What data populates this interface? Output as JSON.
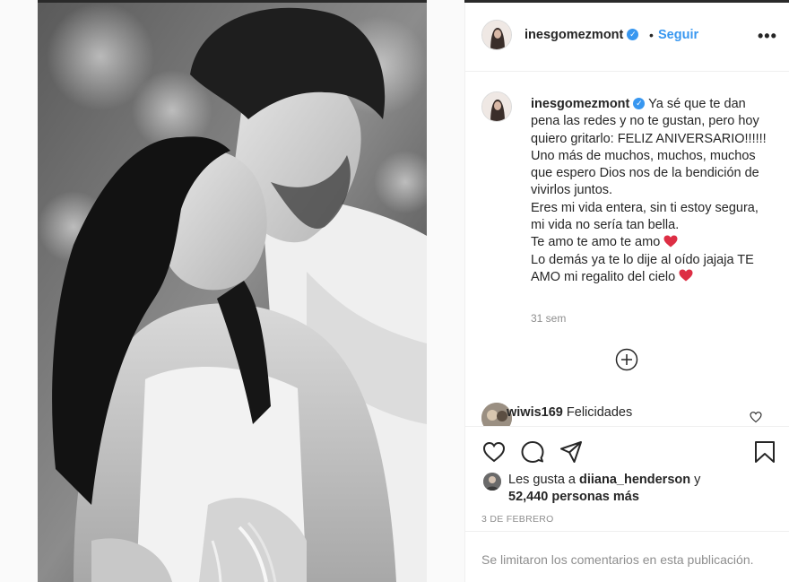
{
  "post": {
    "username": "inesgomezmont",
    "verified_icon": "verified-badge-icon",
    "separator": "•",
    "follow_label": "Seguir",
    "more_icon": "more-options-icon",
    "more_label": "•••"
  },
  "caption": {
    "username": "inesgomezmont",
    "lines": [
      "Ya sé que te dan pena las redes y no te gustan, pero hoy quiero gritarlo: FELIZ ANIVERSARIO!!!!!!",
      "Uno más de muchos, muchos, muchos que espero Dios nos de la bendición de vivirlos juntos.",
      "Eres mi vida entera, sin ti estoy segura, mi vida no sería tan bella.",
      "Te amo te amo te amo",
      "Lo demás ya te lo dije al oído jajaja TE AMO mi regalito del cielo"
    ],
    "heart_emoji": "red-heart-emoji",
    "time": "31 sem",
    "load_more_icon": "plus-circle-icon"
  },
  "comment": {
    "username": "wiwis169",
    "text": "Felicidades",
    "like_icon": "heart-outline-icon"
  },
  "actions": {
    "like_icon": "heart-outline-icon",
    "comment_icon": "comment-bubble-icon",
    "share_icon": "paper-plane-icon",
    "save_icon": "bookmark-icon"
  },
  "likes": {
    "prefix": "Les gusta a",
    "user": "diiana_henderson",
    "conj": "y",
    "count": "52,440 personas más"
  },
  "date": "3 DE FEBRERO",
  "comments_disabled": "Se limitaron los comentarios en esta publicación.",
  "colors": {
    "accent": "#3897f0",
    "text": "#262626",
    "muted": "#8e8e8e",
    "border": "#efefef",
    "heart": "#e0245e"
  }
}
